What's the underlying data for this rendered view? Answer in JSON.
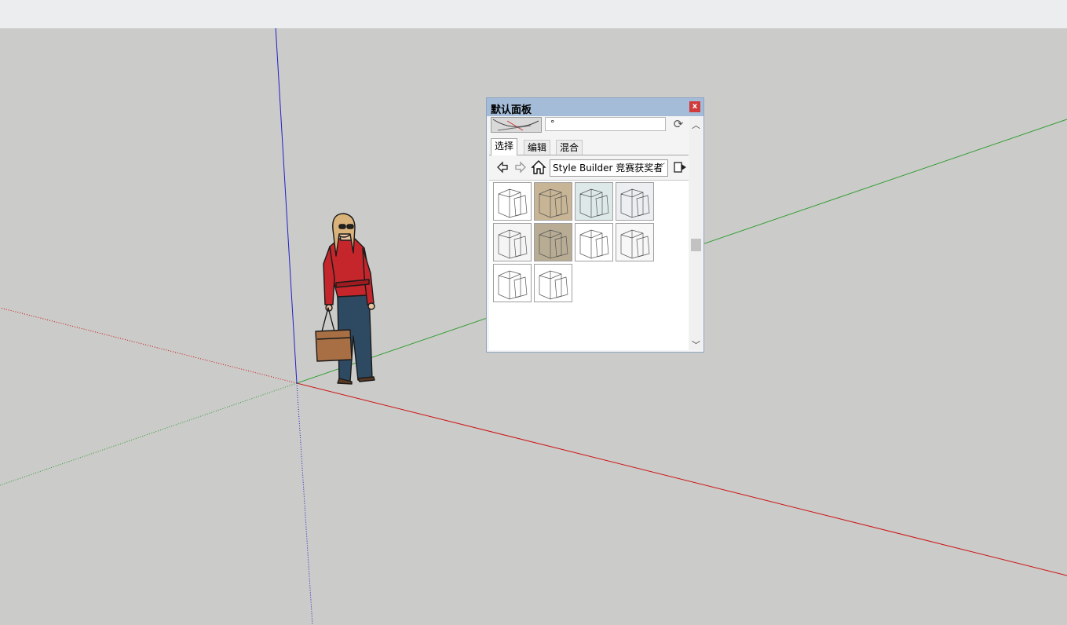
{
  "panel": {
    "title": "默认面板",
    "close_label": "x",
    "style_name_value": "°",
    "tabs": [
      {
        "label": "选择"
      },
      {
        "label": "编辑"
      },
      {
        "label": "混合"
      }
    ],
    "collection_selected": "Style Builder 竞赛获奖者",
    "styles": [
      {
        "bg": "#ffffff"
      },
      {
        "bg": "#c7b595"
      },
      {
        "bg": "#dce9e8"
      },
      {
        "bg": "#eceef2"
      },
      {
        "bg": "#f5f5f5"
      },
      {
        "bg": "#b8ad94"
      },
      {
        "bg": "#ffffff"
      },
      {
        "bg": "#f7f7f7"
      },
      {
        "bg": "#ffffff"
      },
      {
        "bg": "#ffffff"
      }
    ]
  },
  "colors": {
    "axis_red": "#cc1414",
    "axis_green": "#2f9d2f",
    "axis_blue": "#2020c8",
    "viewport_bg": "#cbcbc9",
    "panel_title_bg": "#a4bcd8"
  },
  "icons": [
    "close-icon",
    "refresh-icon",
    "back-arrow-icon",
    "forward-arrow-icon",
    "home-icon",
    "details-icon",
    "scroll-up-icon",
    "scroll-down-icon"
  ]
}
